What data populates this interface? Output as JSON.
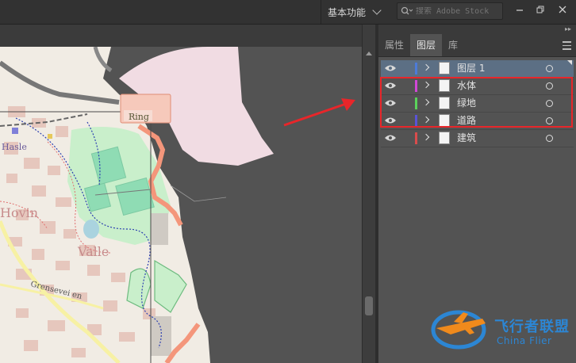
{
  "topbar": {
    "workspace_label": "基本功能",
    "search_placeholder": "搜索 Adobe Stock"
  },
  "panel": {
    "tabs": [
      {
        "label": "属性",
        "active": false
      },
      {
        "label": "图层",
        "active": true
      },
      {
        "label": "库",
        "active": false
      }
    ],
    "layers": [
      {
        "name": "图层 1",
        "color": "#4d7bd8",
        "selected": true
      },
      {
        "name": "水体",
        "color": "#d147d6",
        "selected": false
      },
      {
        "name": "绿地",
        "color": "#5bd35b",
        "selected": false
      },
      {
        "name": "道路",
        "color": "#5a53d6",
        "selected": false
      },
      {
        "name": "建筑",
        "color": "#d94c4c",
        "selected": false
      }
    ]
  },
  "map": {
    "labels": {
      "ring": "Ring",
      "hasle": "Hasle",
      "hovin": "Hovin",
      "valle": "Valle",
      "grenseveien": "Grensevei en"
    }
  },
  "annotation": {
    "highlight_color": "#e8262a"
  },
  "watermark": {
    "cn": "飞行者联盟",
    "en": "China Flier"
  }
}
